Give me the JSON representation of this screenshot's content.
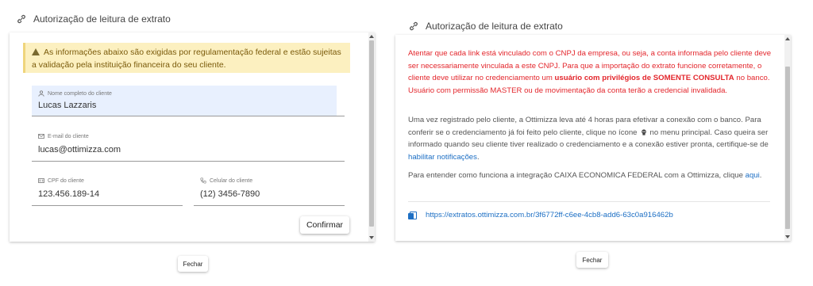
{
  "left_dialog": {
    "title": "Autorização de leitura de extrato",
    "warning": "As informações abaixo são exigidas por regulamentação federal e estão sujeitas a validação pela instituição financeira do seu cliente.",
    "fields": {
      "name": {
        "label": "Nome completo do cliente",
        "value": "Lucas Lazzaris"
      },
      "email": {
        "label": "E-mail do cliente",
        "value": "lucas@ottimizza.com"
      },
      "cpf": {
        "label": "CPF do cliente",
        "value": "123.456.189-14"
      },
      "phone": {
        "label": "Celular do cliente",
        "value": "(12) 3456-7890"
      }
    },
    "confirm_label": "Confirmar",
    "close_label": "Fechar"
  },
  "right_dialog": {
    "title": "Autorização de leitura de extrato",
    "alert_part1": "Atentar que cada link está vinculado com o CNPJ da empresa, ou seja, a conta informada pelo cliente deve ser necessariamente vinculada a este CNPJ. Para que a importação do extrato funcione corretamente, o cliente deve utilizar no credenciamento um ",
    "alert_bold": "usuário com privilégios de SOMENTE CONSULTA",
    "alert_part2": " no banco. Usuário com permissão MASTER ou de movimentação da conta terão a credencial invalidada.",
    "info_part1": "Uma vez registrado pelo cliente, a Ottimizza leva até 4 horas para efetivar a conexão com o banco. Para conferir se o credenciamento já foi feito pelo cliente, clique no ícone",
    "info_part2": "no menu principal. Caso queira ser informado quando seu cliente tiver realizado o credenciamento e a conexão estiver pronta, certifique-se de",
    "info_link": "habilitar notificações",
    "info_end": ".",
    "integration_text": "Para entender como funciona a integração CAIXA ECONOMICA FEDERAL com a Ottimizza, clique",
    "integration_link": "aqui",
    "integration_end": ".",
    "url": "https://extratos.ottimizza.com.br/3f6772ff-c6ee-4cb8-add6-63c0a916462b",
    "close_label": "Fechar"
  },
  "colors": {
    "alert_red": "#e3262c",
    "link_blue": "#1d6fc4",
    "warning_bg": "#fcf0c0"
  }
}
